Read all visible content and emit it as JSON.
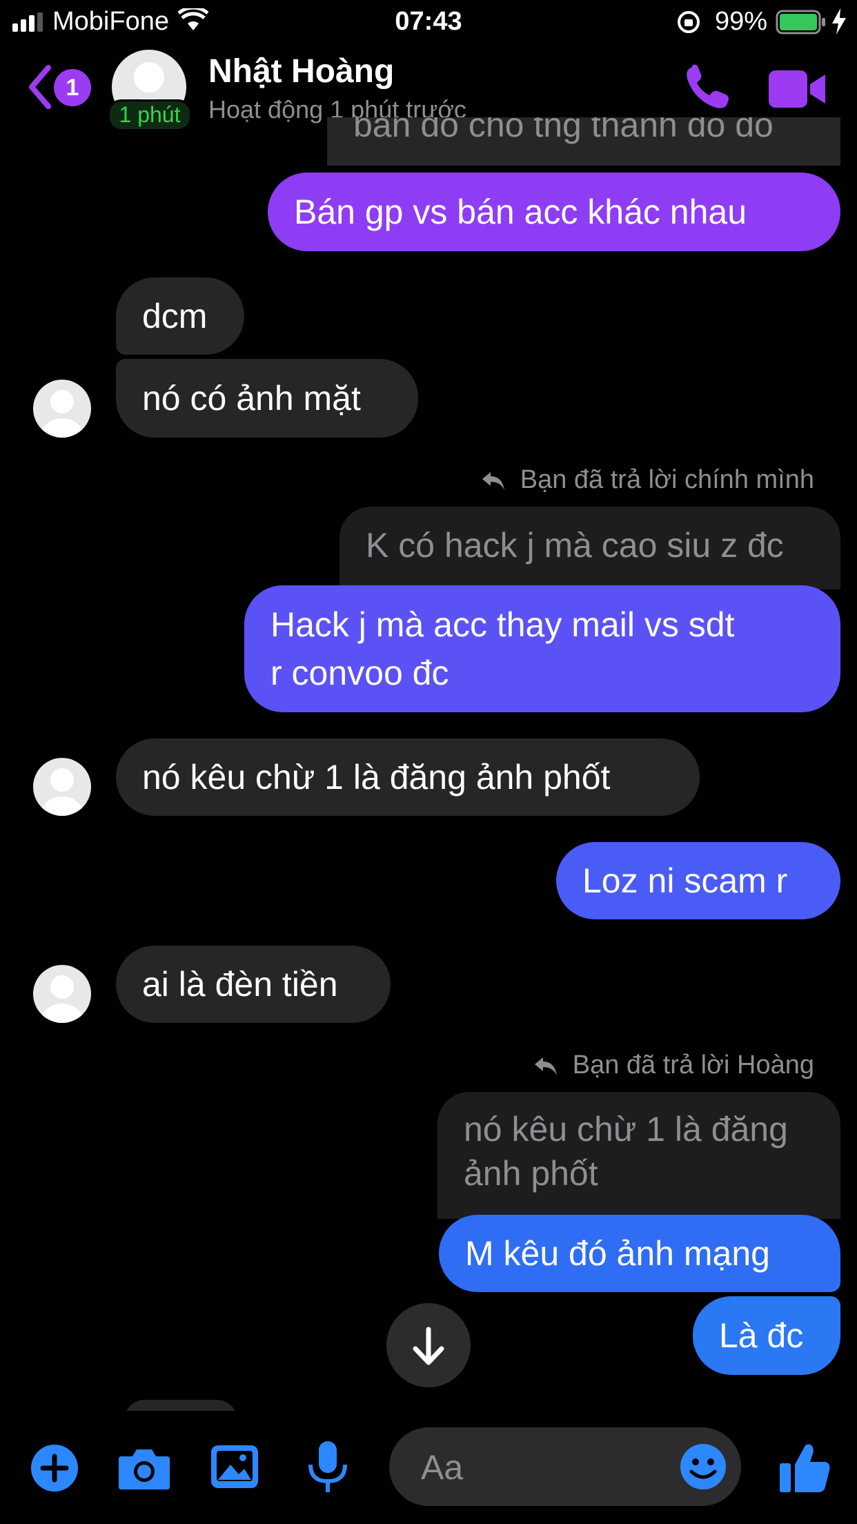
{
  "status_bar": {
    "carrier": "MobiFone",
    "time": "07:43",
    "battery": "99%"
  },
  "header": {
    "back_badge": "1",
    "avatar_badge": "1 phút",
    "contact_name": "Nhật Hoàng",
    "activity": "Hoạt động 1 phút trước"
  },
  "messages": {
    "partial_top": "bán đồ cho tng thành đồ đó",
    "m1": "Bán gp vs bán acc khác nhau",
    "m2": "dcm",
    "m3": "nó có ảnh mặt",
    "reply1_note": "Bạn đã trả lời chính mình",
    "reply1_quote": "K có hack j mà cao siu z đc",
    "m4_line1": "Hack j mà acc thay mail vs sdt",
    "m4_line2": "r convoo đc",
    "m5": "nó kêu chừ 1 là đăng ảnh phốt",
    "m6": "Loz ni scam r",
    "m7": "ai là đèn tiền",
    "reply2_note": "Bạn đã trả lời Hoàng",
    "reply2_quote_line1": "nó kêu chừ 1 là đăng",
    "reply2_quote_line2": "ảnh phốt",
    "m8": "M kêu đó ảnh mạng",
    "m9": "Là đc"
  },
  "composer": {
    "placeholder": "Aa"
  },
  "colors": {
    "accent": "#9b3cf3",
    "purple_bubble": "#8e3df5",
    "indigo_bubble": "#5b52f6",
    "blue_bubble": "#2a78f4",
    "composer_icon_blue": "#2d88ff"
  },
  "icons": [
    "back-chevron-icon",
    "phone-icon",
    "video-camera-icon",
    "scroll-down-icon",
    "plus-icon",
    "camera-icon",
    "gallery-icon",
    "microphone-icon",
    "emoji-icon",
    "thumbs-up-icon",
    "reply-arrow-icon",
    "wifi-icon",
    "signal-icon",
    "battery-icon",
    "charging-icon",
    "orientation-lock-icon"
  ]
}
